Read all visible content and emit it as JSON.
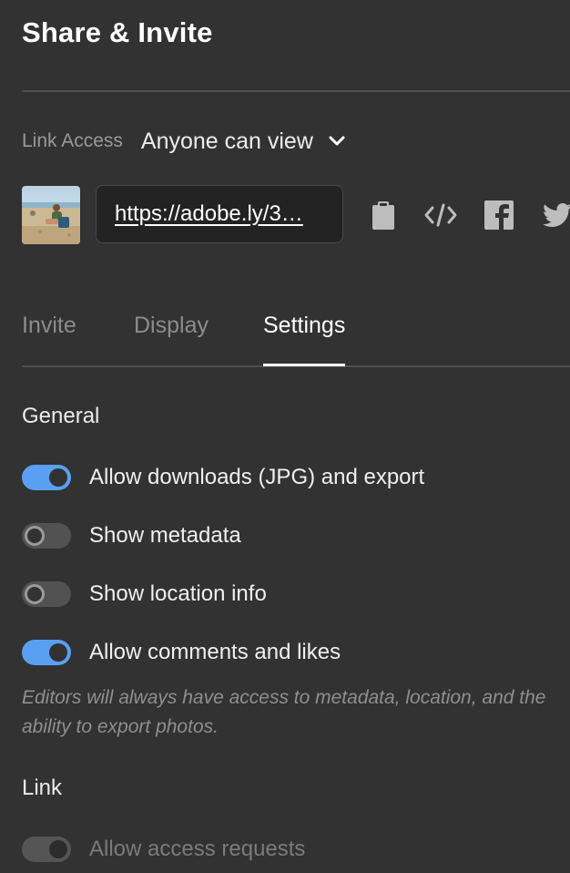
{
  "dialog": {
    "title": "Share & Invite"
  },
  "link_access": {
    "label": "Link Access",
    "value": "Anyone can view"
  },
  "share_link": {
    "url": "https://adobe.ly/3…",
    "icons": [
      "clipboard-icon",
      "embed-code-icon",
      "facebook-icon",
      "twitter-icon"
    ]
  },
  "tabs": [
    {
      "label": "Invite",
      "active": false
    },
    {
      "label": "Display",
      "active": false
    },
    {
      "label": "Settings",
      "active": true
    }
  ],
  "general": {
    "heading": "General",
    "toggles": [
      {
        "label": "Allow downloads (JPG) and export",
        "on": true
      },
      {
        "label": "Show metadata",
        "on": false
      },
      {
        "label": "Show location info",
        "on": false
      },
      {
        "label": "Allow comments and likes",
        "on": true
      }
    ],
    "note": "Editors will always have access to metadata, location, and the ability to export photos."
  },
  "link": {
    "heading": "Link",
    "toggles": [
      {
        "label": "Allow access requests",
        "on": true,
        "disabled": true
      }
    ]
  },
  "colors": {
    "background": "#323232",
    "toggle_on": "#5aa0f2",
    "divider": "#4e4e4e"
  }
}
